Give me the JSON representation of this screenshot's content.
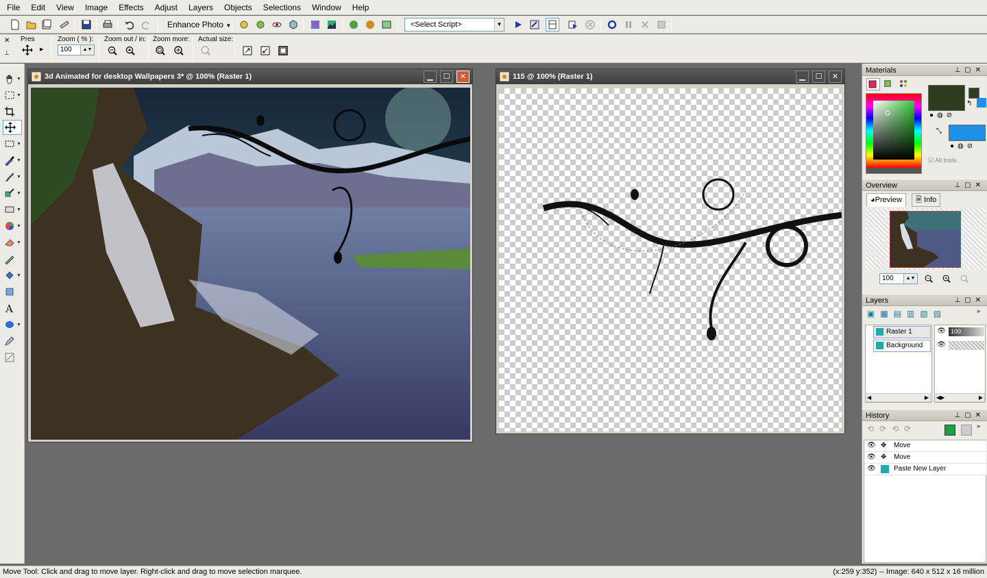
{
  "menu": [
    "File",
    "Edit",
    "View",
    "Image",
    "Effects",
    "Adjust",
    "Layers",
    "Objects",
    "Selections",
    "Window",
    "Help"
  ],
  "toolbar": {
    "enhance_label": "Enhance Photo",
    "script_select": "<Select Script>"
  },
  "tool_options": {
    "pres_label": "Pres",
    "zoom_label": "Zoom ( % ):",
    "zoom_value": "100",
    "zoom_out_in_label": "Zoom out / in:",
    "zoom_more_label": "Zoom more:",
    "actual_size_label": "Actual size:"
  },
  "docs": {
    "doc1_title": "3d Animated for desktop Wallpapers 3* @ 100% (Raster 1)",
    "doc2_title": "115 @ 100% (Raster 1)"
  },
  "panels": {
    "materials": "Materials",
    "all_tools": "All tools",
    "overview": "Overview",
    "preview_tab": "Preview",
    "info_tab": "Info",
    "overview_zoom": "100",
    "layers": "Layers",
    "layer_items": [
      "Raster 1",
      "Background"
    ],
    "opacity": "100",
    "history": "History",
    "history_items": [
      "Move",
      "Move",
      "Paste New Layer"
    ]
  },
  "colors": {
    "foreground": "#2e3d20",
    "background": "#1e90e6"
  },
  "status": {
    "message": "Move Tool: Click and drag to move layer. Right-click and drag to move selection marquee.",
    "info": "(x:259 y:352) -- Image:  640 x 512 x 16 million"
  }
}
